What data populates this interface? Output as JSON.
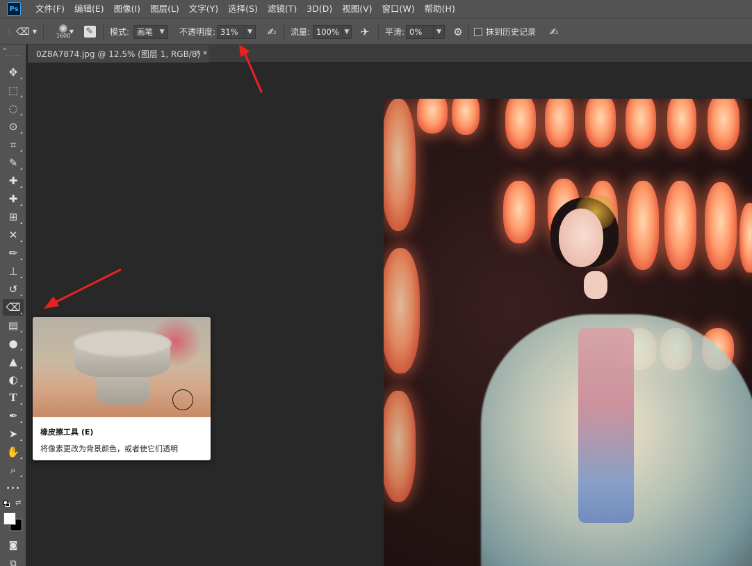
{
  "app": {
    "logo_text": "Ps"
  },
  "menubar": {
    "items": [
      {
        "label": "文件(F)"
      },
      {
        "label": "编辑(E)"
      },
      {
        "label": "图像(I)"
      },
      {
        "label": "图层(L)"
      },
      {
        "label": "文字(Y)"
      },
      {
        "label": "选择(S)"
      },
      {
        "label": "滤镜(T)"
      },
      {
        "label": "3D(D)"
      },
      {
        "label": "视图(V)"
      },
      {
        "label": "窗口(W)"
      },
      {
        "label": "帮助(H)"
      }
    ]
  },
  "options": {
    "brush_size": "1600",
    "mode_label": "模式:",
    "mode_value": "画笔",
    "opacity_label": "不透明度:",
    "opacity_value": "31%",
    "flow_label": "流量:",
    "flow_value": "100%",
    "smoothing_label": "平滑:",
    "smoothing_value": "0%",
    "erase_history_label": "抹到历史记录",
    "erase_history_checked": false
  },
  "document": {
    "tab_label": "0Z8A7874.jpg @ 12.5% (图层 1, RGB/8) *",
    "close_glyph": "×"
  },
  "toolbar": {
    "grip": "»",
    "active_tool": "eraser",
    "tools": [
      {
        "name": "move-tool",
        "glyph": "✥"
      },
      {
        "name": "marquee-tool",
        "glyph": "⬚"
      },
      {
        "name": "lasso-tool",
        "glyph": "◌"
      },
      {
        "name": "quick-select-tool",
        "glyph": "⊙"
      },
      {
        "name": "crop-tool",
        "glyph": "⌗"
      },
      {
        "name": "eyedropper-tool",
        "glyph": "✎"
      },
      {
        "name": "spot-healing-tool",
        "glyph": "✚"
      },
      {
        "name": "healing-brush-tool",
        "glyph": "✚"
      },
      {
        "name": "patch-tool",
        "glyph": "⊞"
      },
      {
        "name": "content-aware-move-tool",
        "glyph": "✕"
      },
      {
        "name": "brush-tool",
        "glyph": "✏"
      },
      {
        "name": "clone-stamp-tool",
        "glyph": "⊥"
      },
      {
        "name": "history-brush-tool",
        "glyph": "↺"
      },
      {
        "name": "eraser-tool",
        "glyph": "⌫"
      },
      {
        "name": "gradient-tool",
        "glyph": "▤"
      },
      {
        "name": "blur-tool",
        "glyph": "●"
      },
      {
        "name": "sharpen-tool",
        "glyph": "▲"
      },
      {
        "name": "dodge-tool",
        "glyph": "◐"
      },
      {
        "name": "type-tool",
        "glyph": "T"
      },
      {
        "name": "pen-tool",
        "glyph": "✒"
      },
      {
        "name": "path-select-tool",
        "glyph": "➤"
      },
      {
        "name": "hand-tool",
        "glyph": "✋"
      },
      {
        "name": "zoom-tool",
        "glyph": "⌕"
      },
      {
        "name": "more-tools",
        "glyph": "•••"
      }
    ]
  },
  "tooltip": {
    "title": "橡皮擦工具 (E)",
    "description": "将像素更改为背景颜色，或者使它们透明"
  },
  "colors": {
    "foreground": "#ffffff",
    "background": "#000000",
    "arrow": "#e8231f"
  }
}
